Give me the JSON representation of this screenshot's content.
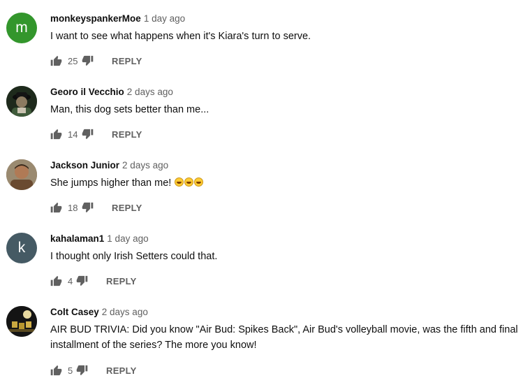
{
  "comments": [
    {
      "avatar_letter": "m",
      "avatar_color": "#33962c",
      "author": "monkeyspankerMoe",
      "time": "1 day ago",
      "text": "I want to see what happens when it's Kiara's turn to serve.",
      "likes": "25",
      "reply_label": "REPLY"
    },
    {
      "avatar_letter": "",
      "avatar_color": "#2d3a2a",
      "author": "Georo il Vecchio",
      "time": "2 days ago",
      "text": "Man, this dog sets better than me...",
      "likes": "14",
      "reply_label": "REPLY"
    },
    {
      "avatar_letter": "",
      "avatar_color": "#7a5a3c",
      "author": "Jackson Junior",
      "time": "2 days ago",
      "text": "She jumps higher than me!",
      "emoji_count": 3,
      "likes": "18",
      "reply_label": "REPLY"
    },
    {
      "avatar_letter": "k",
      "avatar_color": "#455a64",
      "author": "kahalaman1",
      "time": "1 day ago",
      "text": "I thought only Irish Setters could that.",
      "likes": "4",
      "reply_label": "REPLY"
    },
    {
      "avatar_letter": "",
      "avatar_color": "#1a1a1a",
      "author": "Colt Casey",
      "time": "2 days ago",
      "text": "AIR BUD TRIVIA: Did you know \"Air Bud: Spikes Back\", Air Bud's volleyball movie, was the fifth and final installment of the series? The more you know!",
      "likes": "5",
      "reply_label": "REPLY"
    }
  ],
  "icons": {
    "like": "thumb-up-icon",
    "dislike": "thumb-down-icon"
  }
}
